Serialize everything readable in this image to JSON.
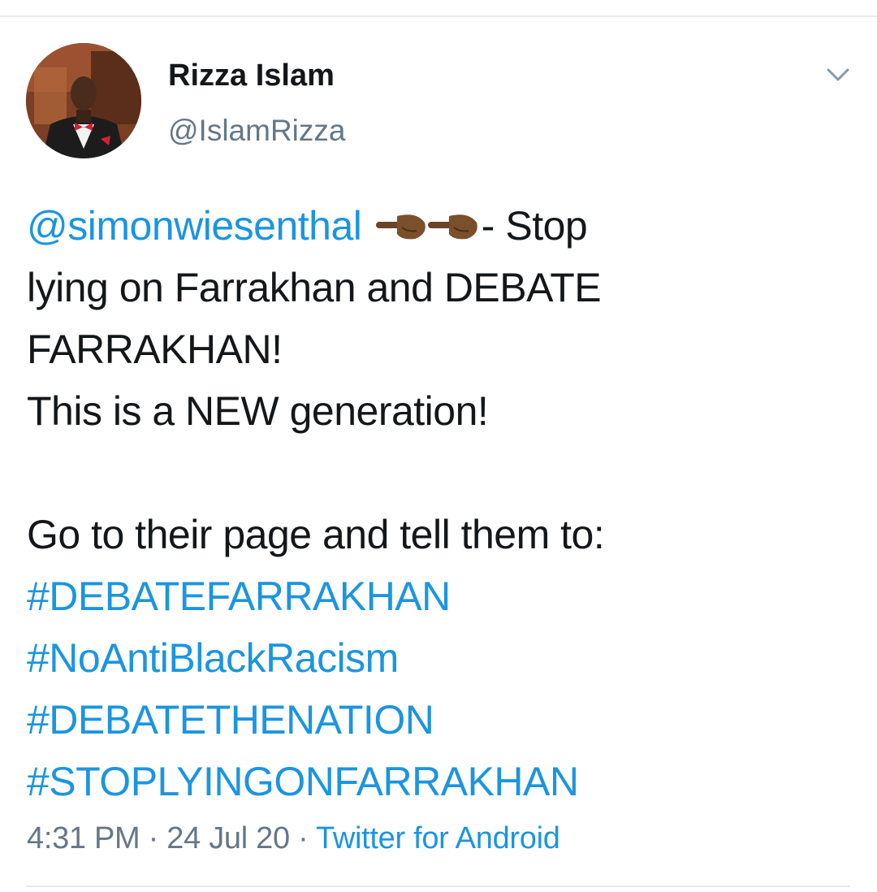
{
  "author": {
    "display_name": "Rizza Islam",
    "handle": "@IslamRizza"
  },
  "tweet": {
    "mention": "@simonwiesenthal",
    "emoji": [
      "backhand-index-pointing-right",
      "backhand-index-pointing-right"
    ],
    "line1_rest": "- Stop",
    "line2": "lying on Farrakhan and DEBATE",
    "line3": "FARRAKHAN!",
    "line4": "This is a NEW generation!",
    "line5": "Go to their page and tell them to:",
    "hashtags": [
      "#DEBATEFARRAKHAN",
      "#NoAntiBlackRacism",
      "#DEBATETHENATION",
      "#STOPLYINGONFARRAKHAN"
    ]
  },
  "meta": {
    "time": "4:31 PM",
    "separator": " · ",
    "date": "24 Jul 20",
    "source": "Twitter for Android"
  },
  "colors": {
    "link": "#1b95e0",
    "text": "#14171a",
    "secondary": "#657786",
    "divider": "#e6ecf0"
  }
}
